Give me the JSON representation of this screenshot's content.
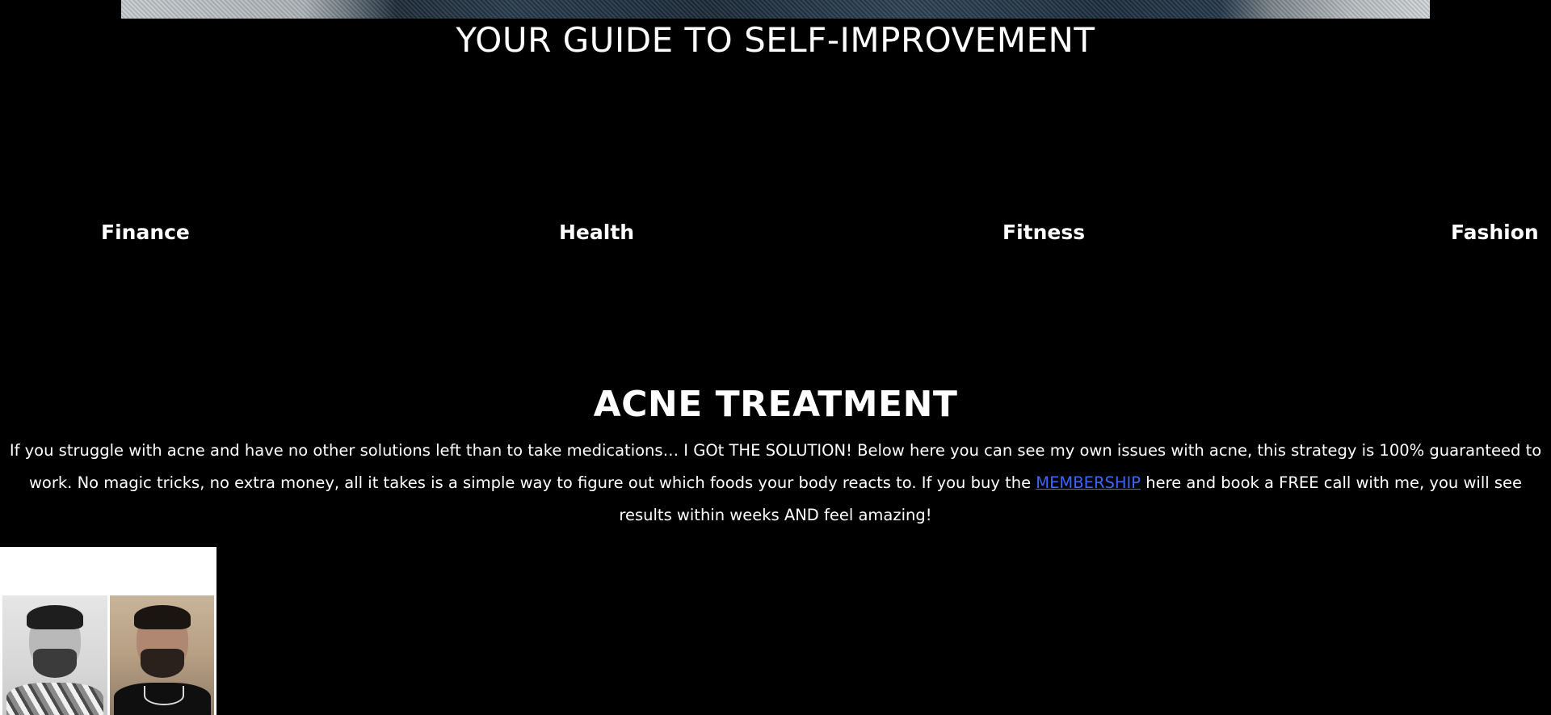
{
  "hero": {
    "title": "YOUR GUIDE TO SELF-IMPROVEMENT"
  },
  "categories": [
    {
      "label": "Finance"
    },
    {
      "label": "Health"
    },
    {
      "label": "Fitness"
    },
    {
      "label": "Fashion"
    }
  ],
  "section": {
    "title": "ACNE TREATMENT",
    "text_before_link": "If you struggle with acne and have no other solutions left than to take medications… I GOt THE SOLUTION! Below here you can see my own issues with acne, this strategy is 100% guaranteed to work. No magic tricks, no extra money, all it takes is a simple way to figure out which foods your body reacts to. If you buy the ",
    "link_text": "MEMBERSHIP",
    "text_after_link": " here and book a FREE call with me, you will see results within weeks AND feel amazing!"
  },
  "colors": {
    "background": "#000000",
    "text": "#ffffff",
    "link": "#3b66ff"
  }
}
